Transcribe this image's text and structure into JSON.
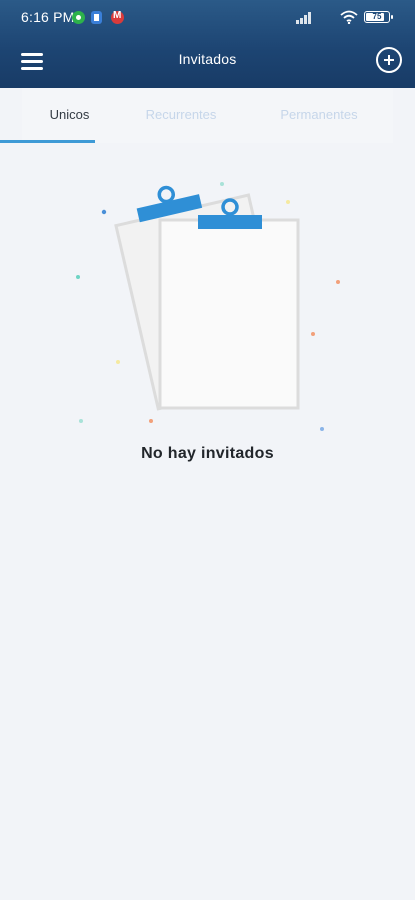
{
  "status_bar": {
    "time": "6:16 PM",
    "battery": "75",
    "notification_icons": [
      "whatsapp-icon",
      "document-icon",
      "gmail-icon"
    ]
  },
  "app_bar": {
    "title": "Invitados",
    "menu_icon": "hamburger-menu-icon",
    "add_icon": "add-circle-icon"
  },
  "tabs": [
    {
      "label": "Unicos",
      "active": true
    },
    {
      "label": "Recurrentes",
      "active": false
    },
    {
      "label": "Permanentes",
      "active": false
    }
  ],
  "empty_state": {
    "message": "No hay invitados",
    "illustration": "clipboards-icon"
  },
  "colors": {
    "header_top": "#2b5a88",
    "header_bottom": "#183b66",
    "accent": "#3e9ad6",
    "background": "#f2f4f8",
    "inactive_tab": "#c6d6ea"
  }
}
